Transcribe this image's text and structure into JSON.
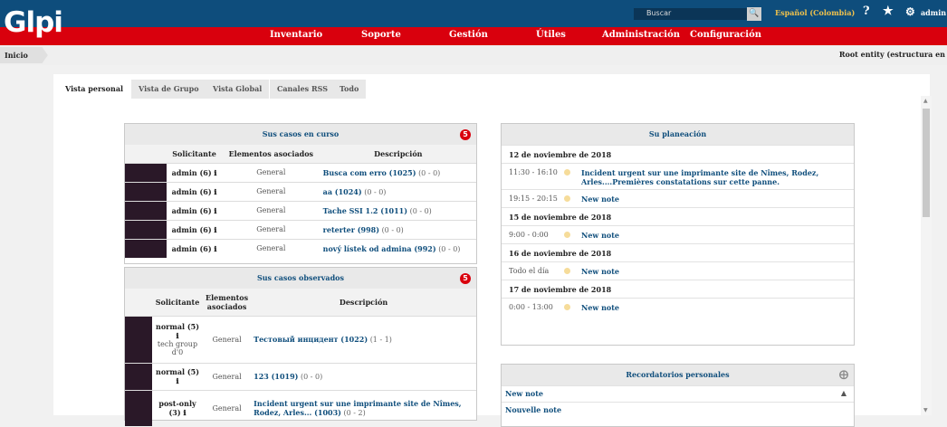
{
  "header": {
    "logo": "Glpi",
    "search_placeholder": "Buscar",
    "language": "Español (Colombia)",
    "user": "admin"
  },
  "menu": [
    "Inventario",
    "Soporte",
    "Gestión",
    "Útiles",
    "Administración",
    "Configuración"
  ],
  "breadcrumb": "Inicio",
  "entity": "Root entity (estructura en",
  "tabs": [
    "Vista personal",
    "Vista de Grupo",
    "Vista Global",
    "Canales RSS",
    "Todo"
  ],
  "current_cases": {
    "title": "Sus casos en curso",
    "count": "5",
    "columns": [
      "Solicitante",
      "Elementos asociados",
      "Descripción"
    ],
    "rows": [
      {
        "requester": "admin (6) ℹ",
        "element": "General",
        "desc": "Busca com erro (1025)",
        "extra": "(0 - 0)"
      },
      {
        "requester": "admin (6) ℹ",
        "element": "General",
        "desc": "aa (1024)",
        "extra": "(0 - 0)"
      },
      {
        "requester": "admin (6) ℹ",
        "element": "General",
        "desc": "Tache SSI 1.2 (1011)",
        "extra": "(0 - 0)"
      },
      {
        "requester": "admin (6) ℹ",
        "element": "General",
        "desc": "reterter (998)",
        "extra": "(0 - 0)"
      },
      {
        "requester": "admin (6) ℹ",
        "element": "General",
        "desc": "nový lístek od admina (992)",
        "extra": "(0 - 0)"
      }
    ]
  },
  "observed_cases": {
    "title": "Sus casos observados",
    "count": "5",
    "columns": [
      "Solicitante",
      "Elementos asociados",
      "Descripción"
    ],
    "rows": [
      {
        "requester": "normal (5) ℹ",
        "group": "tech group d'0",
        "element": "General",
        "desc": "Тестовый инцидент (1022)",
        "extra": "(1 - 1)"
      },
      {
        "requester": "normal (5) ℹ",
        "group": "",
        "element": "General",
        "desc": "123 (1019)",
        "extra": "(0 - 0)"
      },
      {
        "requester": "post-only (3) ℹ",
        "group": "",
        "element": "General",
        "desc": "Incident urgent sur une imprimante site de Nîmes, Rodez, Arles... (1003)",
        "extra": "(0 - 2)"
      }
    ]
  },
  "planning": {
    "title": "Su planeación",
    "days": [
      {
        "date": "12 de noviembre de 2018",
        "events": [
          {
            "time": "11:30 - 16:10",
            "text": "Incident urgent sur une imprimante site de Nîmes, Rodez, Arles....Premières constatations sur cette panne."
          },
          {
            "time": "19:15 - 20:15",
            "text": "New note"
          }
        ]
      },
      {
        "date": "15 de noviembre de 2018",
        "events": [
          {
            "time": "9:00 - 0:00",
            "text": "New note"
          }
        ]
      },
      {
        "date": "16 de noviembre de 2018",
        "events": [
          {
            "time": "Todo el día",
            "text": "New note"
          }
        ]
      },
      {
        "date": "17 de noviembre de 2018",
        "events": [
          {
            "time": "0:00 - 13:00",
            "text": "New note"
          }
        ]
      }
    ]
  },
  "reminders": {
    "title": "Recordatorios personales",
    "items": [
      "New note",
      "Nouvelle note"
    ]
  }
}
